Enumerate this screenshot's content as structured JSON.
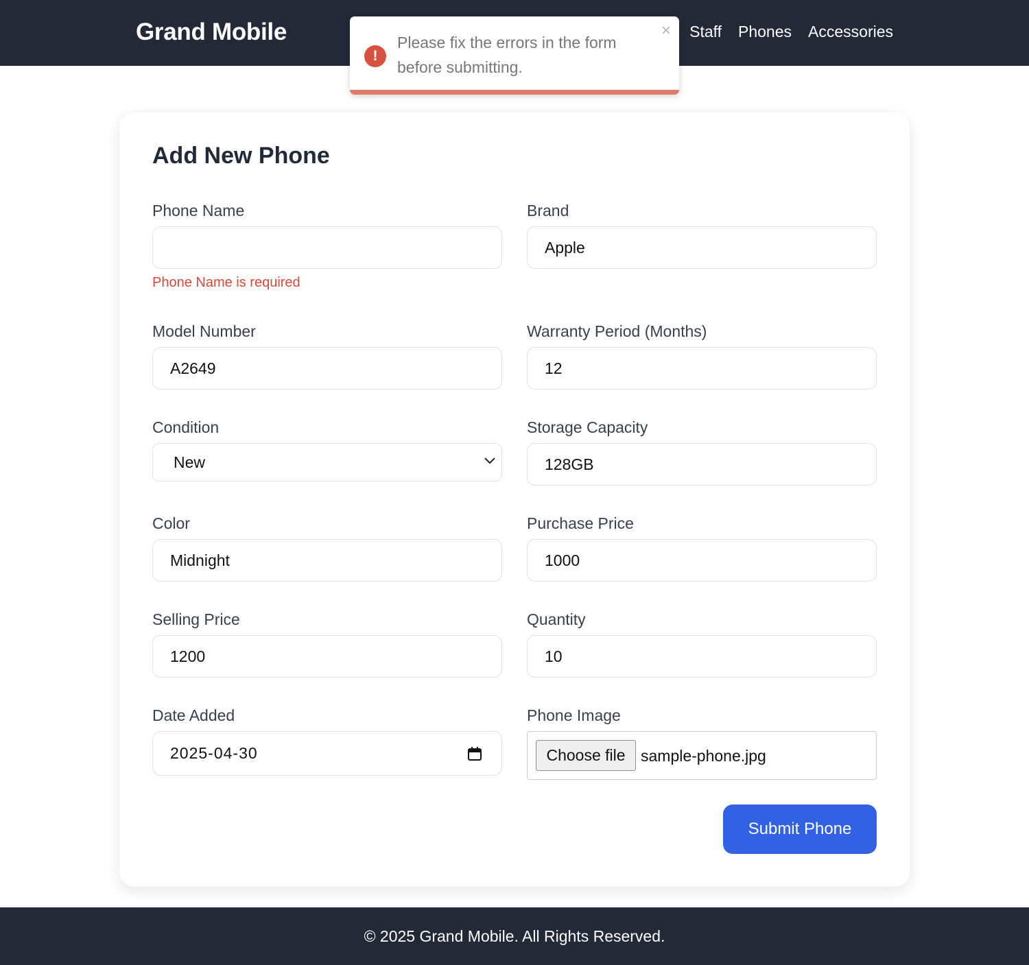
{
  "header": {
    "brand": "Grand Mobile",
    "nav": [
      "Staff",
      "Phones",
      "Accessories"
    ]
  },
  "toast": {
    "message": "Please fix the errors in the form before submitting.",
    "close": "×",
    "icon": "alert-circle-icon"
  },
  "form": {
    "title": "Add New Phone",
    "phone_name": {
      "label": "Phone Name",
      "value": "",
      "error": "Phone Name is required"
    },
    "brand": {
      "label": "Brand",
      "value": "Apple"
    },
    "model_number": {
      "label": "Model Number",
      "value": "A2649"
    },
    "warranty": {
      "label": "Warranty Period (Months)",
      "value": "12"
    },
    "condition": {
      "label": "Condition",
      "value": "New"
    },
    "storage": {
      "label": "Storage Capacity",
      "value": "128GB"
    },
    "color": {
      "label": "Color",
      "value": "Midnight"
    },
    "purchase_price": {
      "label": "Purchase Price",
      "value": "1000"
    },
    "selling_price": {
      "label": "Selling Price",
      "value": "1200"
    },
    "quantity": {
      "label": "Quantity",
      "value": "10"
    },
    "date_added": {
      "label": "Date Added",
      "value": "2025-04-30"
    },
    "phone_image": {
      "label": "Phone Image",
      "button": "Choose file",
      "file_name": "sample-phone.jpg"
    },
    "submit": "Submit Phone"
  },
  "footer": {
    "text": "© 2025 Grand Mobile. All Rights Reserved."
  },
  "colors": {
    "header_bg": "#232937",
    "accent": "#3361e3",
    "error": "#d5483c"
  }
}
